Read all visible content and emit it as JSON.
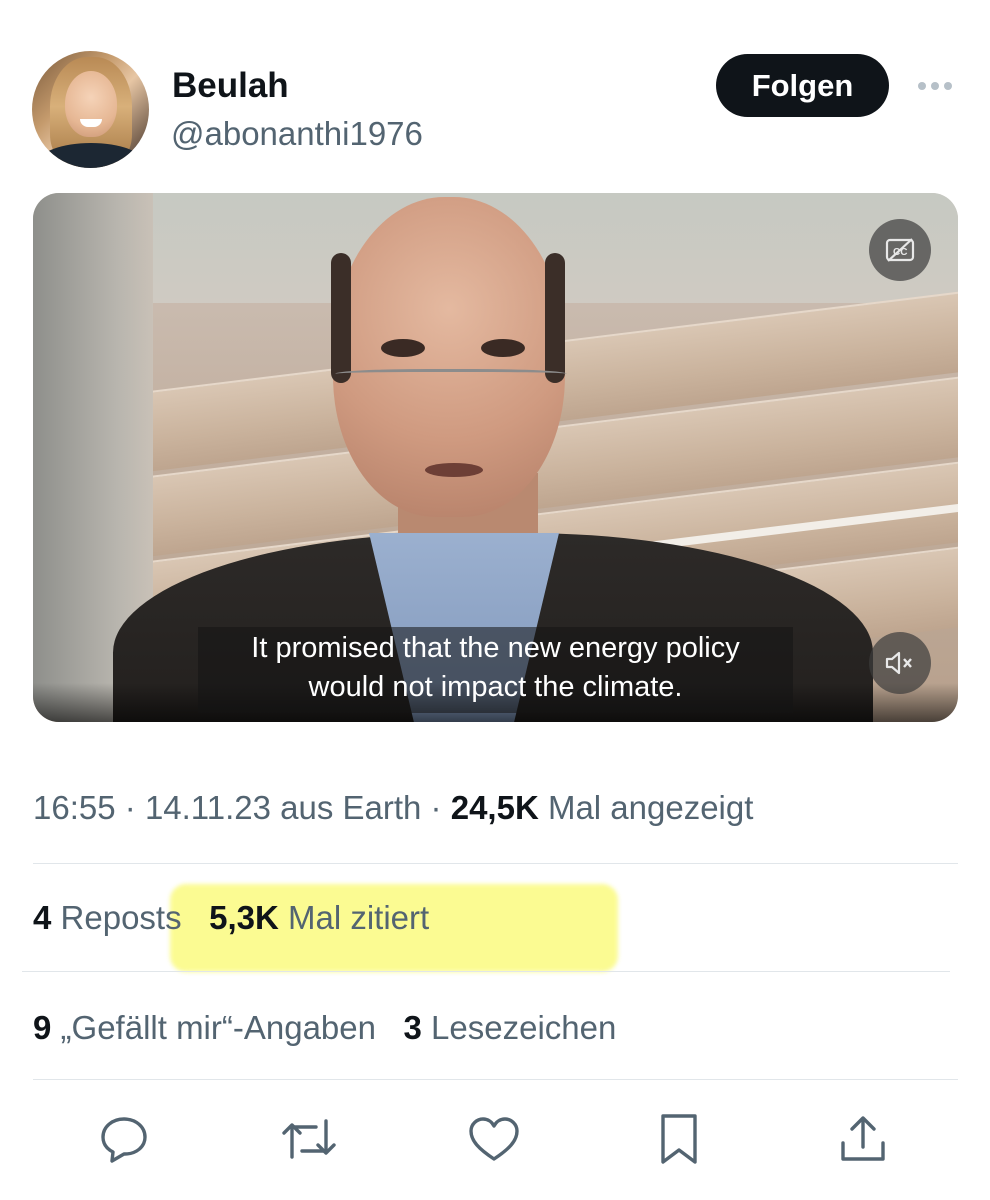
{
  "user": {
    "display_name": "Beulah",
    "handle": "@abonanthi1976"
  },
  "follow_label": "Folgen",
  "video": {
    "subtitle_line1": "It promised that the new energy policy",
    "subtitle_line2": "would not impact the climate.",
    "cc_icon": "closed-captions-off-icon",
    "mute_icon": "volume-muted-icon"
  },
  "meta": {
    "time": "16:55",
    "date": "14.11.23",
    "location": "aus Earth",
    "views_count": "24,5K",
    "views_label": "Mal angezeigt",
    "separator": "·"
  },
  "stats": {
    "reposts_count": "4",
    "reposts_label": "Reposts",
    "quotes_count": "5,3K",
    "quotes_label": "Mal zitiert",
    "likes_count": "9",
    "likes_label": "„Gefällt mir“-Angaben",
    "bookmarks_count": "3",
    "bookmarks_label": "Lesezeichen"
  },
  "colors": {
    "text_primary": "#0f1419",
    "text_secondary": "#536471",
    "highlight": "#fafa6e"
  },
  "actions": [
    "reply-icon",
    "repost-icon",
    "like-icon",
    "bookmark-icon",
    "share-icon"
  ]
}
